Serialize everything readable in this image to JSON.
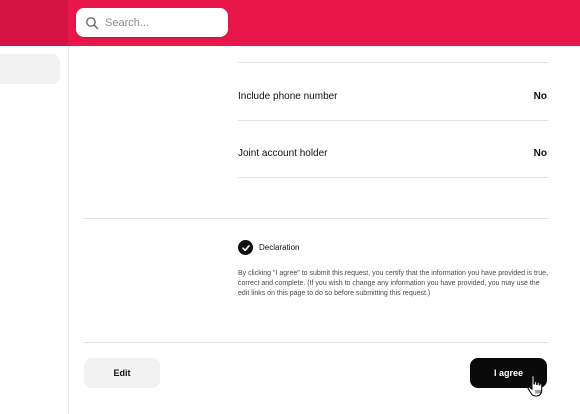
{
  "header": {
    "brand_color": "#e8174a",
    "search": {
      "placeholder": "Search...",
      "value": ""
    }
  },
  "form": {
    "rows": [
      {
        "label": "Include phone number",
        "value": "No"
      },
      {
        "label": "Joint account holder",
        "value": "No"
      }
    ],
    "declaration": {
      "checked": true,
      "title": "Declaration",
      "text": "By clicking \"I agree\" to submit this request, you certify that the information you have provided is true, correct and complete. (If you wish to change any information you have provided, you may use the edit links on this page to do so before submitting this request.)"
    }
  },
  "actions": {
    "edit_label": "Edit",
    "agree_label": "I agree"
  },
  "icons": {
    "search": "search-icon",
    "check": "checkmark-icon",
    "cursor": "hand-pointer-cursor-icon"
  }
}
